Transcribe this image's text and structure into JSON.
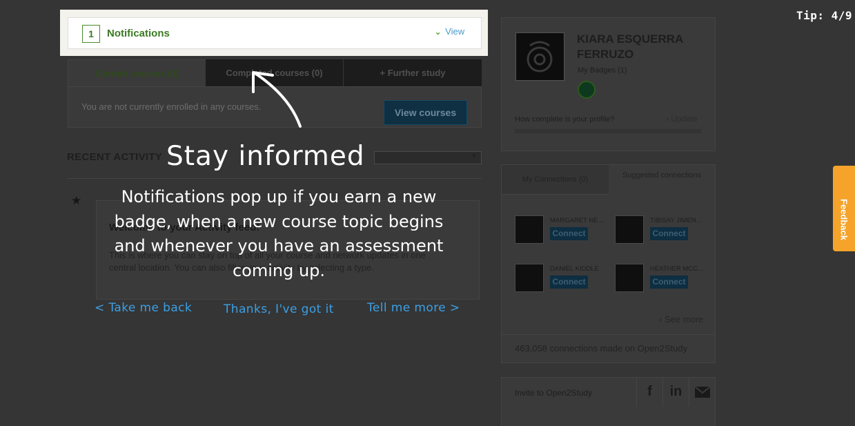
{
  "notification": {
    "count": "1",
    "title": "Notifications",
    "view_label": "View"
  },
  "courses": {
    "tabs": [
      "Current courses (0)",
      "Completed courses (0)",
      "+ Further study"
    ],
    "empty_message": "You are not currently enrolled in any courses.",
    "view_button": "View courses"
  },
  "activity": {
    "title": "RECENT ACTIVITY",
    "welcome_title": "Welcome to your Activity feed!",
    "welcome_text": "This is where you can stay on top of all your course and network updates in one central location. You can also filter your activity by selecting a type."
  },
  "profile": {
    "name": "KIARA ESQUERRA FERRUZO",
    "badges": "My Badges (1)",
    "complete_question": "How complete is your profile?",
    "update_label": "Update",
    "progress": 0
  },
  "connections": {
    "tab_mine": "My Connections (0)",
    "tab_suggested": "Suggested connections",
    "people": [
      {
        "name": "MARGARET NE...",
        "button": "Connect"
      },
      {
        "name": "TIBISAY JIMEN...",
        "button": "Connect"
      },
      {
        "name": "DANIEL KIDDLE",
        "button": "Connect"
      },
      {
        "name": "HEATHER MCC...",
        "button": "Connect"
      }
    ],
    "see_more": "See more",
    "count_text": "463,058 connections made on Open2Study"
  },
  "invite": {
    "label": "Invite to Open2Study",
    "icons": [
      "facebook-icon",
      "linkedin-icon",
      "mail-icon"
    ]
  },
  "tour": {
    "tip_counter": "Tip: 4/9",
    "heading": "Stay informed",
    "body": "Notifications pop up if you earn a new badge, when a new course topic begins and whenever you have an assessment coming up.",
    "back": "< Take me back",
    "dismiss": "Thanks, I've got it",
    "more": "Tell me more >"
  },
  "feedback": {
    "label": "Feedback",
    "color": "#f5a32a"
  }
}
